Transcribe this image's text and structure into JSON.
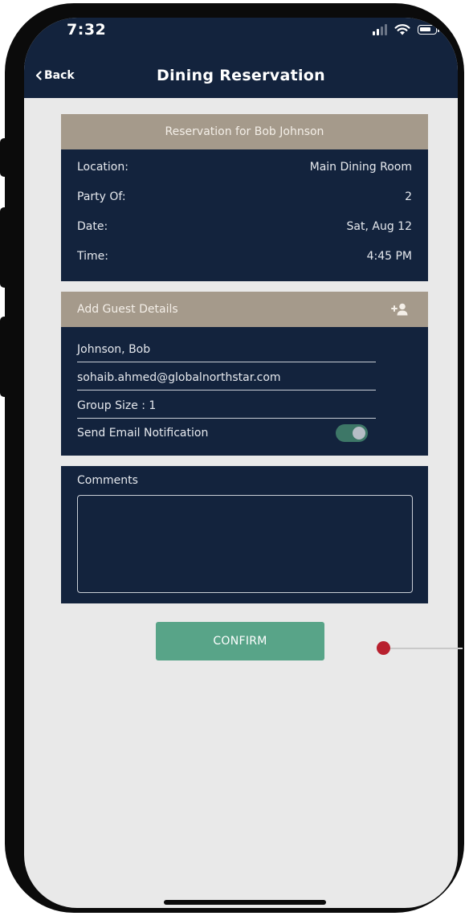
{
  "status_bar": {
    "time": "7:32"
  },
  "nav": {
    "back_label": "Back",
    "title": "Dining Reservation"
  },
  "reservation": {
    "header": "Reservation for Bob Johnson",
    "rows": [
      {
        "label": "Location:",
        "value": "Main Dining Room"
      },
      {
        "label": "Party Of:",
        "value": "2"
      },
      {
        "label": "Date:",
        "value": "Sat, Aug 12"
      },
      {
        "label": "Time:",
        "value": "4:45 PM"
      }
    ]
  },
  "guest_details": {
    "header": "Add Guest Details",
    "name": "Johnson, Bob",
    "email": "sohaib.ahmed@globalnorthstar.com",
    "group_size": "Group Size : 1",
    "notification_label": "Send Email Notification",
    "notification_enabled": true
  },
  "comments": {
    "label": "Comments",
    "value": ""
  },
  "confirm_label": "CONFIRM",
  "colors": {
    "navy": "#13233d",
    "tan": "#a59a8b",
    "green": "#58a488",
    "background": "#e9e9e9",
    "pointer": "#b8202e"
  }
}
